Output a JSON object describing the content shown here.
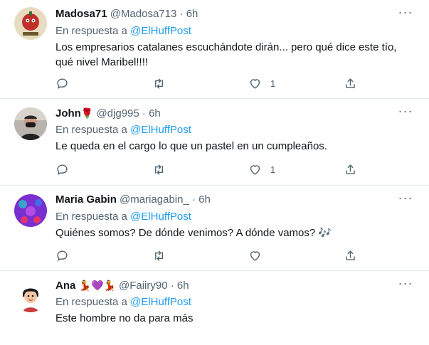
{
  "tweets": [
    {
      "name": "Madosa71",
      "name_emoji": "",
      "handle": "@Madosa713",
      "time": "6h",
      "reply_prefix": "En respuesta a",
      "reply_to": "@ElHuffPost",
      "text": "Los empresarios catalanes escuchándote dirán... pero qué dice este tío, qué nivel Maribel!!!!",
      "avatar": "madosa-avatar",
      "reply_count": "",
      "retweet_count": "",
      "like_count": "1"
    },
    {
      "name": "John",
      "name_emoji": "🌹",
      "handle": "@djg995",
      "time": "6h",
      "reply_prefix": "En respuesta a",
      "reply_to": "@ElHuffPost",
      "text": "Le queda en el cargo lo que un pastel en un cumpleaños.",
      "avatar": "john-avatar",
      "reply_count": "",
      "retweet_count": "",
      "like_count": "1"
    },
    {
      "name": "Maria Gabin",
      "name_emoji": "",
      "handle": "@mariagabin_",
      "time": "6h",
      "reply_prefix": "En respuesta a",
      "reply_to": "@ElHuffPost",
      "text": "Quiénes somos? De dónde venimos? A dónde vamos? 🎶",
      "avatar": "maria-avatar",
      "reply_count": "",
      "retweet_count": "",
      "like_count": ""
    },
    {
      "name": "Ana",
      "name_emoji": "💃💜💃",
      "handle": "@Faiiry90",
      "time": "6h",
      "reply_prefix": "En respuesta a",
      "reply_to": "@ElHuffPost",
      "text": "Este hombre no da para más",
      "avatar": "ana-avatar",
      "reply_count": "",
      "retweet_count": "",
      "like_count": ""
    }
  ],
  "separator": "·",
  "more_glyph": "···",
  "colors": {
    "link": "#1d9bf0",
    "muted": "#536471",
    "text": "#0f1419",
    "divider": "#e6ecf0"
  },
  "icons": [
    "reply-icon",
    "retweet-icon",
    "like-icon",
    "share-icon",
    "more-icon"
  ]
}
